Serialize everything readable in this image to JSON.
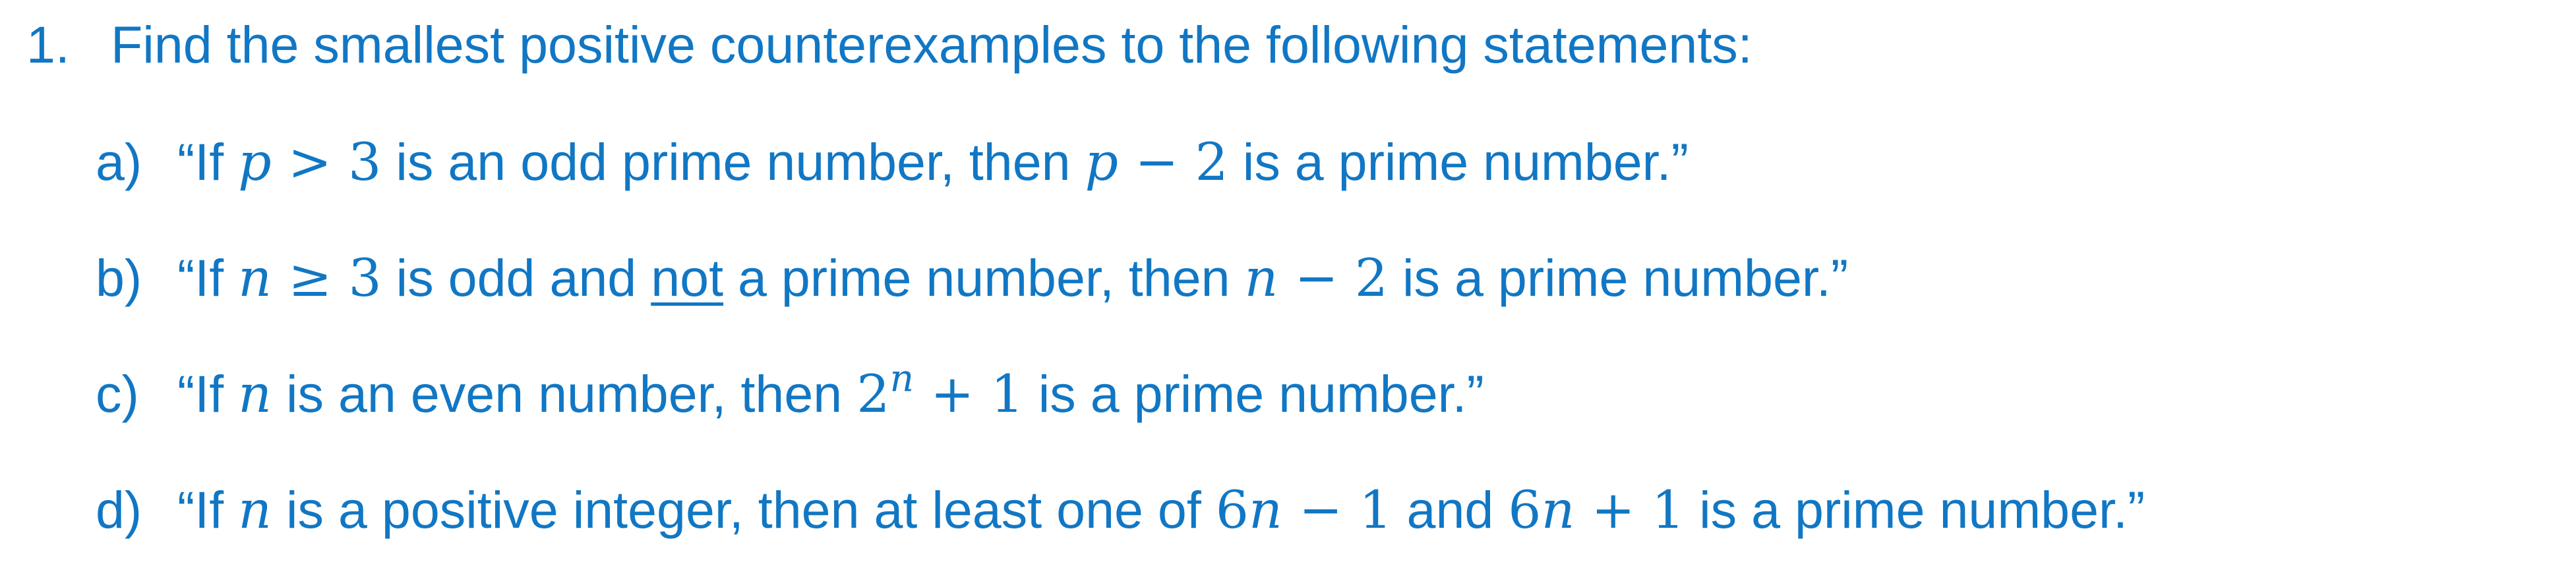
{
  "question": {
    "number": "1.",
    "text": "Find the smallest positive counterexamples to the following statements:"
  },
  "items": {
    "a": {
      "letter": "a)",
      "t1": "“If ",
      "m1v": "p",
      "m1r": " > 3",
      "t2": " is an odd prime number, then ",
      "m2v": "p",
      "m2r": " − 2",
      "t3": " is a prime number.”"
    },
    "b": {
      "letter": "b)",
      "t1": "“If ",
      "m1v": "n",
      "m1r": " ≥ 3",
      "t2": " is odd and ",
      "underlined": "not",
      "t3": " a prime number, then ",
      "m2v": "n",
      "m2r": " − 2",
      "t4": " is a prime number.”"
    },
    "c": {
      "letter": "c)",
      "t1": "“If ",
      "m1v": "n",
      "t2": " is an even number, then ",
      "m2base": "2",
      "m2exp": "n",
      "m2rest": " + 1",
      "t3": " is a prime number.”"
    },
    "d": {
      "letter": "d)",
      "t1": "“If ",
      "m1v": "n",
      "t2": " is a positive integer, then at least one of ",
      "m2c": "6",
      "m2v": "n",
      "m2r": " − 1",
      "t3": " and ",
      "m3c": "6",
      "m3v": "n",
      "m3r": " + 1",
      "t4": " is a prime number.”"
    }
  }
}
